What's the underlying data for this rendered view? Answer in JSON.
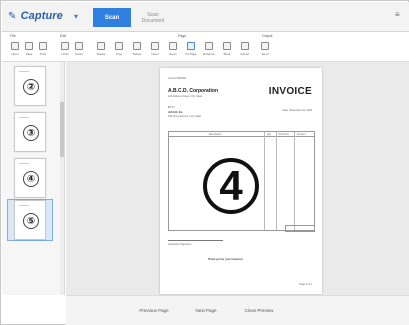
{
  "app": {
    "logo_text": "Capture",
    "primary_button": "Scan",
    "secondary_button_line1": "Scan",
    "secondary_button_line2": "Document"
  },
  "ribbon": {
    "groups": [
      "File",
      "Edit",
      "Page",
      "Output"
    ],
    "tools": [
      {
        "label": "Open",
        "icon": "folder-icon"
      },
      {
        "label": "Save",
        "icon": "save-icon"
      },
      {
        "label": "Print",
        "icon": "print-icon"
      },
      {
        "label": "Undo",
        "icon": "undo-icon"
      },
      {
        "label": "Redo",
        "icon": "redo-icon"
      },
      {
        "label": "Rotate",
        "icon": "rotate-icon"
      },
      {
        "label": "Crop",
        "icon": "crop-icon"
      },
      {
        "label": "Delete",
        "icon": "delete-icon"
      },
      {
        "label": "Insert",
        "icon": "insert-icon"
      },
      {
        "label": "Zoom",
        "icon": "zoom-icon"
      },
      {
        "label": "Fit Page",
        "icon": "fit-page-icon"
      },
      {
        "label": "Enhance",
        "icon": "enhance-icon"
      },
      {
        "label": "Mark",
        "icon": "mark-icon"
      },
      {
        "label": "Export",
        "icon": "export-icon"
      },
      {
        "label": "Send",
        "icon": "send-icon"
      }
    ]
  },
  "thumbnails": [
    {
      "label": "②"
    },
    {
      "label": "③"
    },
    {
      "label": "④"
    },
    {
      "label": "⑤",
      "selected": true
    }
  ],
  "document": {
    "title": "INVOICE",
    "company": "A.B.C.D. Corporation",
    "big_number": "4",
    "bill_to": "Bill To",
    "client": "A.B.C.D. Inc.",
    "date": "Date: September 22, 2018",
    "table_headers": [
      "Description",
      "Qty",
      "Unit Price",
      "Amount"
    ],
    "footer_note": "Thank you for your business!"
  },
  "bottombar": {
    "buttons": [
      "Previous Page",
      "Next Page",
      "Close Preview"
    ]
  }
}
